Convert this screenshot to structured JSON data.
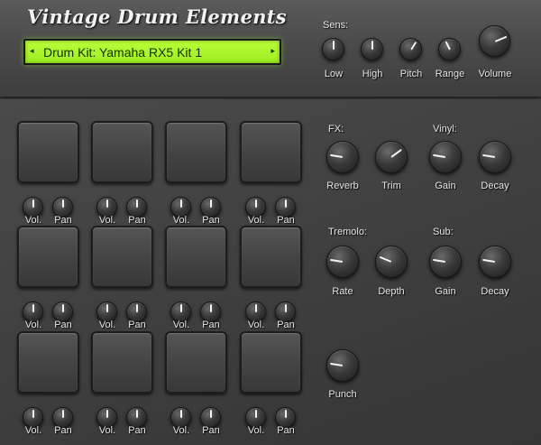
{
  "app": {
    "title": "Vintage Drum Elements"
  },
  "display": {
    "text": "Drum Kit:  Yamaha RX5 Kit 1",
    "left_arrow": "◂",
    "right_arrow": "▸"
  },
  "sens": {
    "label": "Sens:",
    "knobs": [
      {
        "label": "Low",
        "value": 0.5
      },
      {
        "label": "High",
        "value": 0.5
      },
      {
        "label": "Pitch",
        "value": 0.62
      },
      {
        "label": "Range",
        "value": 0.4
      }
    ]
  },
  "volume": {
    "label": "Volume",
    "value": 0.75
  },
  "pads": {
    "count": 12,
    "vol_label": "Vol.",
    "pan_label": "Pan"
  },
  "fx": {
    "label": "FX:",
    "knobs": [
      {
        "label": "Reverb",
        "value": 0.2
      },
      {
        "label": "Trim",
        "value": 0.7
      }
    ]
  },
  "vinyl": {
    "label": "Vinyl:",
    "knobs": [
      {
        "label": "Gain",
        "value": 0.2
      },
      {
        "label": "Decay",
        "value": 0.2
      }
    ]
  },
  "tremolo": {
    "label": "Tremolo:",
    "knobs": [
      {
        "label": "Rate",
        "value": 0.2
      },
      {
        "label": "Depth",
        "value": 0.25
      }
    ]
  },
  "sub": {
    "label": "Sub:",
    "knobs": [
      {
        "label": "Gain",
        "value": 0.2
      },
      {
        "label": "Decay",
        "value": 0.2
      }
    ]
  },
  "punch": {
    "label": "Punch",
    "value": 0.2
  }
}
